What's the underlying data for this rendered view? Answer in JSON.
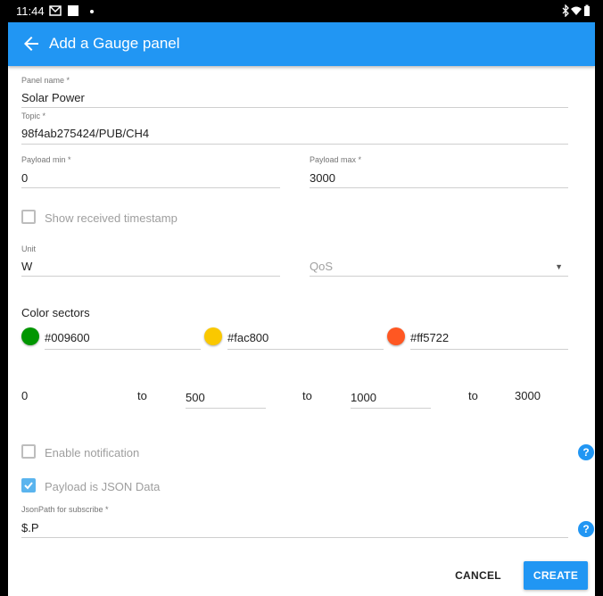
{
  "status_bar": {
    "time": "11:44"
  },
  "app_bar": {
    "title": "Add a Gauge panel",
    "back_icon": "arrow-left-icon"
  },
  "form": {
    "panel_name": {
      "label": "Panel name *",
      "value": "Solar Power"
    },
    "topic": {
      "label": "Topic *",
      "value": "98f4ab275424/PUB/CH4"
    },
    "payload_min": {
      "label": "Payload min *",
      "value": "0"
    },
    "payload_max": {
      "label": "Payload max *",
      "value": "3000"
    },
    "show_timestamp": {
      "label": "Show received timestamp",
      "checked": false
    },
    "unit": {
      "label": "Unit",
      "value": "W"
    },
    "qos": {
      "placeholder": "QoS",
      "selected": ""
    },
    "color_sectors": {
      "title": "Color sectors",
      "colors": [
        "#009600",
        "#fac800",
        "#ff5722"
      ],
      "ranges": {
        "start": "0",
        "to_label": "to",
        "boundary_1": "500",
        "boundary_2": "1000",
        "end": "3000"
      }
    },
    "enable_notification": {
      "label": "Enable notification",
      "checked": false
    },
    "payload_json": {
      "label": "Payload is JSON Data",
      "checked": true
    },
    "json_path": {
      "label": "JsonPath for subscribe *",
      "value": "$.P"
    }
  },
  "actions": {
    "cancel_label": "CANCEL",
    "create_label": "CREATE"
  },
  "colors": {
    "primary": "#2196f3",
    "checkbox_checked": "#5ab4ee"
  }
}
